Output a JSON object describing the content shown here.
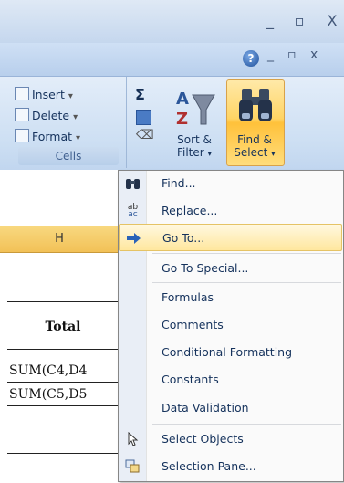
{
  "window": {
    "min_glyph": "_",
    "max_glyph": "▫",
    "close_glyph": "X"
  },
  "help": {
    "glyph": "?",
    "min_glyph": "_",
    "restore_glyph": "▫",
    "close_glyph": "x"
  },
  "ribbon": {
    "cells": {
      "insert_label": "Insert",
      "delete_label": "Delete",
      "format_label": "Format",
      "group_label": "Cells",
      "dropdown_glyph": "▾"
    },
    "editing": {
      "sum_glyph": "Σ",
      "sort_label": "Sort &",
      "filter_label": "Filter",
      "find_label": "Find &",
      "select_label": "Select"
    }
  },
  "sheet": {
    "column_header": "H",
    "total_header": "Total",
    "formulas": [
      "SUM(C4,D4",
      "SUM(C5,D5"
    ]
  },
  "menu": {
    "items": [
      {
        "label": "Find...",
        "icon": "binoculars-icon",
        "glyph": "🔍"
      },
      {
        "label": "Replace...",
        "icon": "replace-icon",
        "glyph": "ab"
      },
      {
        "label": "Go To...",
        "icon": "arrow-right-icon",
        "glyph": "➡"
      },
      {
        "label": "Go To Special...",
        "icon": "",
        "glyph": ""
      },
      {
        "label": "Formulas",
        "icon": "",
        "glyph": ""
      },
      {
        "label": "Comments",
        "icon": "",
        "glyph": ""
      },
      {
        "label": "Conditional Formatting",
        "icon": "",
        "glyph": ""
      },
      {
        "label": "Constants",
        "icon": "",
        "glyph": ""
      },
      {
        "label": "Data Validation",
        "icon": "",
        "glyph": ""
      },
      {
        "label": "Select Objects",
        "icon": "cursor-icon",
        "glyph": "↖"
      },
      {
        "label": "Selection Pane...",
        "icon": "selection-pane-icon",
        "glyph": "▦"
      }
    ],
    "highlighted_index": 2
  }
}
